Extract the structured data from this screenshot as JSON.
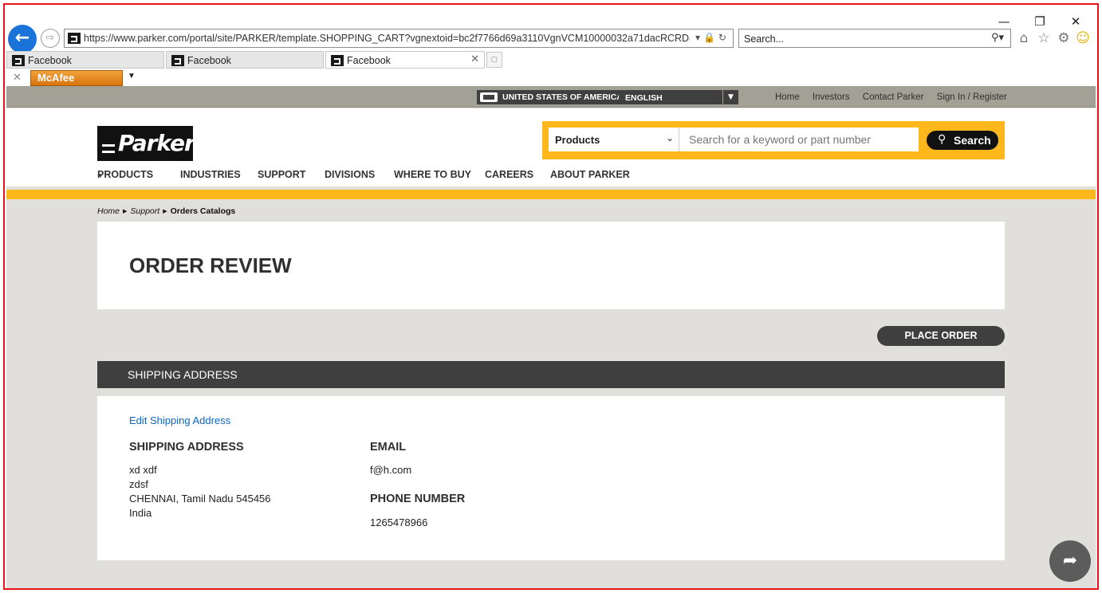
{
  "browser": {
    "url": "https://www.parker.com/portal/site/PARKER/template.SHOPPING_CART?vgnextoid=bc2f7766d69a3110VgnVCM10000032a71dacRCRD&sessionIc",
    "search_placeholder": "Search...",
    "tabs": [
      {
        "label": "Facebook"
      },
      {
        "label": "Facebook"
      },
      {
        "label": "Facebook"
      }
    ],
    "toolbar_addon": "McAfee"
  },
  "site": {
    "country": "UNITED STATES OF AMERICA",
    "language": "ENGLISH",
    "top_links": [
      "Home",
      "Investors",
      "Contact Parker",
      "Sign In / Register"
    ],
    "logo_text": "Parker",
    "search": {
      "category": "Products",
      "placeholder": "Search for a keyword or part number",
      "button": "Search"
    },
    "nav": [
      "PRODUCTS",
      "INDUSTRIES",
      "SUPPORT",
      "DIVISIONS",
      "WHERE TO BUY",
      "CAREERS",
      "ABOUT PARKER"
    ],
    "breadcrumb": [
      "Home",
      "Support",
      "Orders Catalogs"
    ]
  },
  "page": {
    "title": "ORDER REVIEW",
    "place_order": "PLACE ORDER",
    "section_title": "SHIPPING ADDRESS",
    "edit_link": "Edit Shipping Address",
    "shipping": {
      "label": "SHIPPING ADDRESS",
      "lines": [
        "xd xdf",
        "zdsf",
        "CHENNAI, Tamil Nadu 545456",
        "India"
      ]
    },
    "email": {
      "label": "EMAIL",
      "value": "f@h.com"
    },
    "phone": {
      "label": "PHONE NUMBER",
      "value": "1265478966"
    }
  },
  "colors": {
    "accent_yellow": "#ffb81c",
    "dark_gray": "#3f3f3f",
    "link_blue": "#0a66c2",
    "frame_red": "#e8141b"
  }
}
